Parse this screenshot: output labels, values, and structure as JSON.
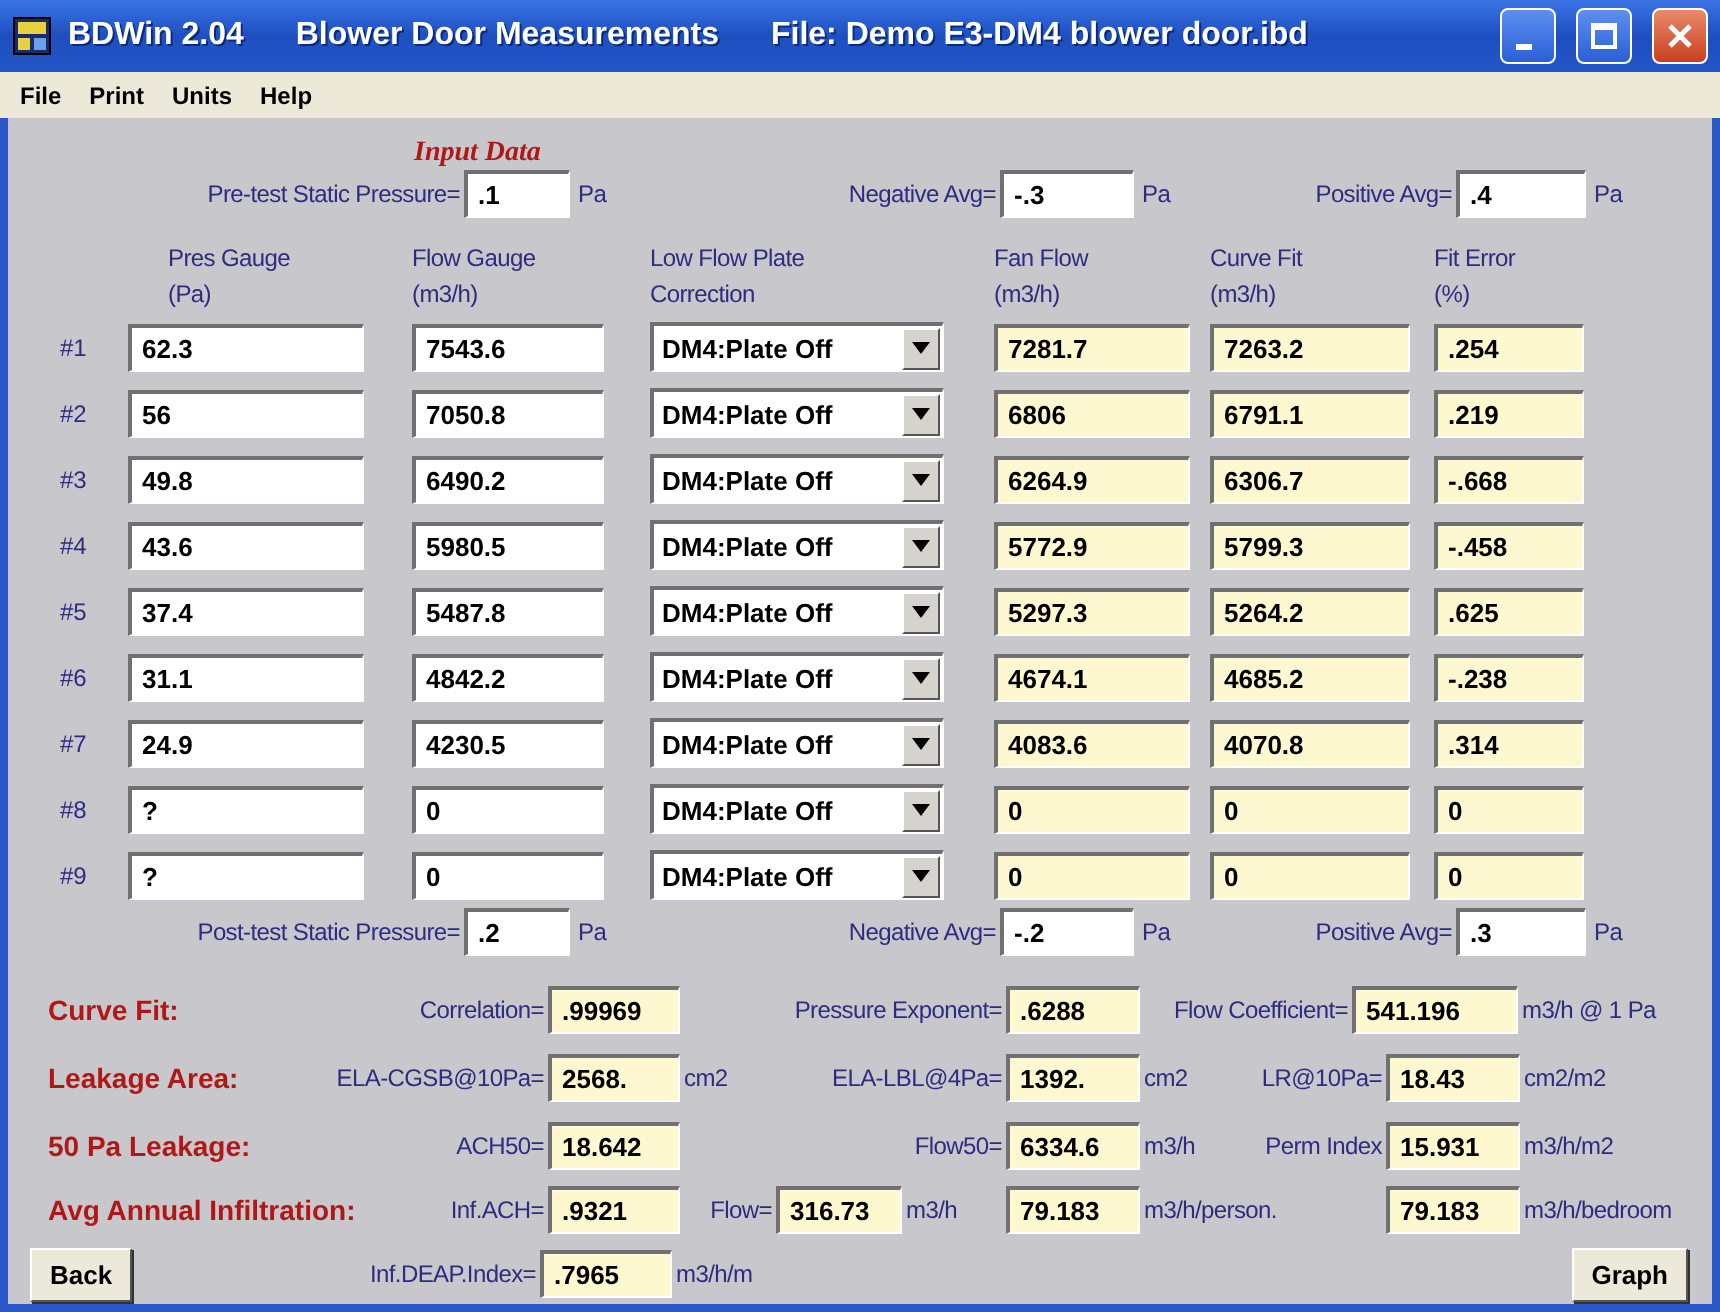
{
  "window": {
    "title_parts": [
      "BDWin 2.04",
      "Blower Door Measurements",
      "File: Demo E3-DM4 blower door.ibd"
    ]
  },
  "menu": [
    "File",
    "Print",
    "Units",
    "Help"
  ],
  "input_data_label": "Input Data",
  "pre_test": [
    {
      "label": "Pre-test Static Pressure=",
      "value": ".1",
      "unit": "Pa"
    },
    {
      "label": "Negative Avg=",
      "value": "-.3",
      "unit": "Pa"
    },
    {
      "label": "Positive Avg=",
      "value": ".4",
      "unit": "Pa"
    }
  ],
  "table": {
    "columns": [
      {
        "title": "Pres Gauge",
        "unit": "(Pa)"
      },
      {
        "title": "Flow Gauge",
        "unit": "(m3/h)"
      },
      {
        "title": "Low Flow Plate",
        "unit": "Correction"
      },
      {
        "title": "Fan Flow",
        "unit": "(m3/h)"
      },
      {
        "title": "Curve Fit",
        "unit": "(m3/h)"
      },
      {
        "title": "Fit Error",
        "unit": "(%)"
      }
    ],
    "rows": [
      {
        "label": "#1",
        "pres_gauge": "62.3",
        "flow_gauge": "7543.6",
        "plate": "DM4:Plate Off",
        "fan_flow": "7281.7",
        "curve_fit": "7263.2",
        "fit_error": ".254"
      },
      {
        "label": "#2",
        "pres_gauge": "56",
        "flow_gauge": "7050.8",
        "plate": "DM4:Plate Off",
        "fan_flow": "6806",
        "curve_fit": "6791.1",
        "fit_error": ".219"
      },
      {
        "label": "#3",
        "pres_gauge": "49.8",
        "flow_gauge": "6490.2",
        "plate": "DM4:Plate Off",
        "fan_flow": "6264.9",
        "curve_fit": "6306.7",
        "fit_error": "-.668"
      },
      {
        "label": "#4",
        "pres_gauge": "43.6",
        "flow_gauge": "5980.5",
        "plate": "DM4:Plate Off",
        "fan_flow": "5772.9",
        "curve_fit": "5799.3",
        "fit_error": "-.458"
      },
      {
        "label": "#5",
        "pres_gauge": "37.4",
        "flow_gauge": "5487.8",
        "plate": "DM4:Plate Off",
        "fan_flow": "5297.3",
        "curve_fit": "5264.2",
        "fit_error": ".625"
      },
      {
        "label": "#6",
        "pres_gauge": "31.1",
        "flow_gauge": "4842.2",
        "plate": "DM4:Plate Off",
        "fan_flow": "4674.1",
        "curve_fit": "4685.2",
        "fit_error": "-.238"
      },
      {
        "label": "#7",
        "pres_gauge": "24.9",
        "flow_gauge": "4230.5",
        "plate": "DM4:Plate Off",
        "fan_flow": "4083.6",
        "curve_fit": "4070.8",
        "fit_error": ".314"
      },
      {
        "label": "#8",
        "pres_gauge": "?",
        "flow_gauge": "0",
        "plate": "DM4:Plate Off",
        "fan_flow": "0",
        "curve_fit": "0",
        "fit_error": "0"
      },
      {
        "label": "#9",
        "pres_gauge": "?",
        "flow_gauge": "0",
        "plate": "DM4:Plate Off",
        "fan_flow": "0",
        "curve_fit": "0",
        "fit_error": "0"
      }
    ]
  },
  "post_test": [
    {
      "label": "Post-test Static Pressure=",
      "value": ".2",
      "unit": "Pa"
    },
    {
      "label": "Negative Avg=",
      "value": "-.2",
      "unit": "Pa"
    },
    {
      "label": "Positive Avg=",
      "value": ".3",
      "unit": "Pa"
    }
  ],
  "results": [
    {
      "items": [
        {
          "kind": "heading",
          "text": "Curve Fit:"
        },
        {
          "kind": "label",
          "text": "Correlation="
        },
        {
          "kind": "value",
          "text": ".99969"
        },
        {
          "kind": "label",
          "text": "Pressure Exponent="
        },
        {
          "kind": "value",
          "text": ".6288"
        },
        {
          "kind": "label",
          "text": "Flow Coefficient="
        },
        {
          "kind": "value",
          "text": "541.196"
        },
        {
          "kind": "unit",
          "text": "m3/h @ 1 Pa"
        }
      ]
    },
    {
      "items": [
        {
          "kind": "heading",
          "text": "Leakage Area:"
        },
        {
          "kind": "label",
          "text": "ELA-CGSB@10Pa="
        },
        {
          "kind": "value",
          "text": "2568."
        },
        {
          "kind": "unit",
          "text": "cm2"
        },
        {
          "kind": "label",
          "text": "ELA-LBL@4Pa="
        },
        {
          "kind": "value",
          "text": "1392."
        },
        {
          "kind": "unit",
          "text": "cm2"
        },
        {
          "kind": "label",
          "text": "LR@10Pa="
        },
        {
          "kind": "value",
          "text": "18.43"
        },
        {
          "kind": "unit",
          "text": "cm2/m2"
        }
      ]
    },
    {
      "items": [
        {
          "kind": "heading",
          "text": "50 Pa Leakage:"
        },
        {
          "kind": "label",
          "text": "ACH50="
        },
        {
          "kind": "value",
          "text": "18.642"
        },
        {
          "kind": "label",
          "text": "Flow50="
        },
        {
          "kind": "value",
          "text": "6334.6"
        },
        {
          "kind": "unit",
          "text": "m3/h"
        },
        {
          "kind": "label",
          "text": "Perm Index"
        },
        {
          "kind": "value",
          "text": "15.931"
        },
        {
          "kind": "unit",
          "text": "m3/h/m2"
        }
      ]
    },
    {
      "items": [
        {
          "kind": "heading",
          "text": "Avg Annual Infiltration:"
        },
        {
          "kind": "label",
          "text": "Inf.ACH="
        },
        {
          "kind": "value",
          "text": ".9321"
        },
        {
          "kind": "label",
          "text": "Flow="
        },
        {
          "kind": "value",
          "text": "316.73"
        },
        {
          "kind": "unit",
          "text": "m3/h"
        },
        {
          "kind": "value",
          "text": "79.183"
        },
        {
          "kind": "unit",
          "text": "m3/h/person."
        },
        {
          "kind": "value",
          "text": "79.183"
        },
        {
          "kind": "unit",
          "text": "m3/h/bedroom"
        }
      ]
    },
    {
      "items": [
        {
          "kind": "button",
          "text": "Back"
        },
        {
          "kind": "label",
          "text": "Inf.DEAP.Index="
        },
        {
          "kind": "value",
          "text": ".7965"
        },
        {
          "kind": "unit",
          "text": "m3/h/m"
        },
        {
          "kind": "button",
          "text": "Graph"
        }
      ]
    }
  ]
}
